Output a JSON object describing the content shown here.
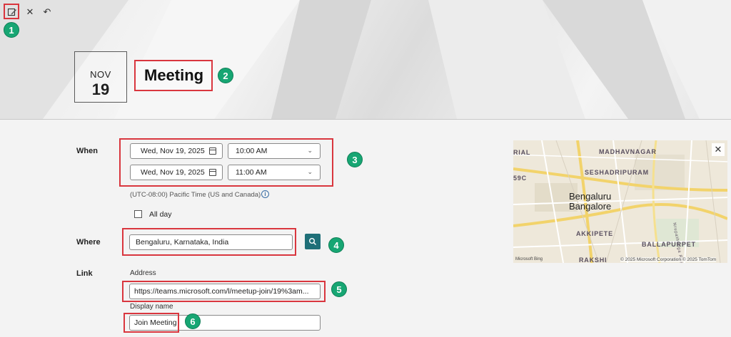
{
  "toolbar": {
    "edit_icon": "edit-icon",
    "close_icon": "close-icon",
    "undo_icon": "undo-icon"
  },
  "event": {
    "month": "NOV",
    "day": "19",
    "title": "Meeting"
  },
  "badges": [
    "1",
    "2",
    "3",
    "4",
    "5",
    "6"
  ],
  "when": {
    "label": "When",
    "start_date": "Wed, Nov 19, 2025",
    "start_time": "10:00 AM",
    "end_date": "Wed, Nov 19, 2025",
    "end_time": "11:00 AM",
    "timezone": "(UTC-08:00) Pacific Time (US and Canada)",
    "all_day_label": "All day",
    "all_day_checked": false
  },
  "where": {
    "label": "Where",
    "value": "Bengaluru, Karnataka, India"
  },
  "link": {
    "label": "Link",
    "address_label": "Address",
    "address_value": "https://teams.microsoft.com/l/meetup-join/19%3am...",
    "display_name_label": "Display name",
    "display_name_value": "Join Meeting"
  },
  "map": {
    "labels": [
      "MADHAVNAGAR",
      "SESHADRIPURAM",
      "AKKIPETE",
      "BALLAPURPET",
      "RIAL",
      "59C",
      "RAKSHI",
      "Nrupathunga Road"
    ],
    "city_primary": "Bengaluru",
    "city_secondary": "Bangalore",
    "logo_text": "Microsoft Bing",
    "copyright": "© 2025 Microsoft Corporation © 2025 TomTom"
  },
  "colors": {
    "accent": "#1f6f78",
    "highlight": "#d9363e",
    "badge": "#17a673"
  }
}
